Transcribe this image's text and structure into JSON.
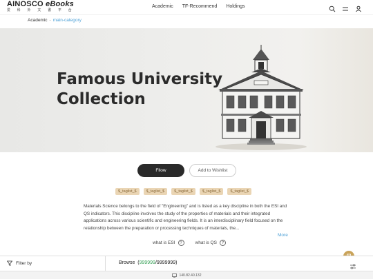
{
  "header": {
    "brand": "AINOSCO",
    "brand_suffix": "eBooks",
    "brand_sub": "爱 科 外 文 書 平 台",
    "nav": [
      "Academic",
      "TF-Recommend",
      "Holdings"
    ],
    "icons": [
      "search-icon",
      "menu-lines-icon",
      "user-icon"
    ]
  },
  "breadcrumb": {
    "root": "Academic",
    "separator": "-",
    "current": "main-category"
  },
  "banner": {
    "title_line1": "Famous University",
    "title_line2": "Collection"
  },
  "actions": {
    "follow": "Fllow",
    "wishlist": "Add to Wishlist"
  },
  "tags": [
    "$_taglist_$",
    "$_taglist_$",
    "$_taglist_$",
    "$_taglist_$",
    "$_taglist_$"
  ],
  "description": "Materials Science belongs to the field of \"Engineering\" and is listed as a key discipline in both the ESI and QS indicators. This discipline involves the study of the properties of materials and their integrated applications across various scientific and engineering fields. It is an interdisciplinary field focused on the relationship between the preparation or processing techniques of materials, the...",
  "more": "More",
  "what_is": [
    "what is ESI",
    "what is QS"
  ],
  "bottom": {
    "filter_label": "Filter by",
    "browse_label": "Browse",
    "browse_count": "999999",
    "browse_total": "9999999"
  },
  "status": {
    "ip": "140.82.40.132"
  },
  "colors": {
    "accent_blue": "#4a9fd6",
    "tag_bg": "#ead5b4",
    "browse_green": "#3aa35a",
    "fab": "#c9a35a"
  }
}
